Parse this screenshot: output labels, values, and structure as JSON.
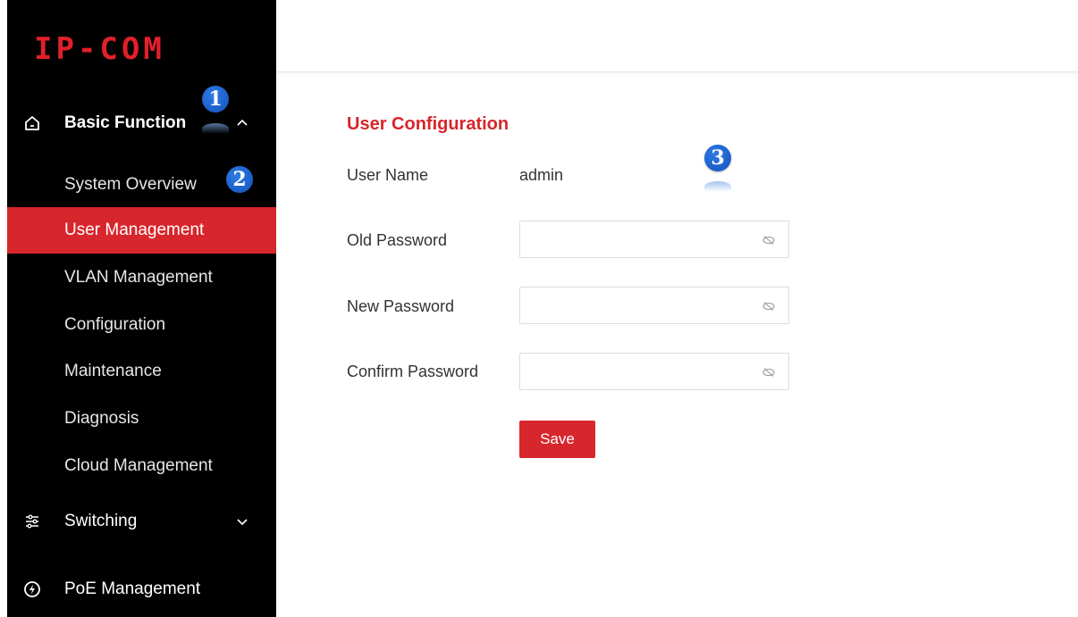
{
  "logo": {
    "text": "IP-COM"
  },
  "sidebar": {
    "groups": [
      {
        "label": "Basic Function",
        "icon": "home-icon",
        "expanded": true
      },
      {
        "label": "Switching",
        "icon": "sliders-icon",
        "expanded": false
      },
      {
        "label": "PoE Management",
        "icon": "power-icon"
      }
    ],
    "items": [
      {
        "label": "System Overview"
      },
      {
        "label": "User Management",
        "active": true
      },
      {
        "label": "VLAN Management"
      },
      {
        "label": "Configuration"
      },
      {
        "label": "Maintenance"
      },
      {
        "label": "Diagnosis"
      },
      {
        "label": "Cloud Management"
      }
    ]
  },
  "badges": [
    "1",
    "2",
    "3"
  ],
  "content": {
    "title": "User Configuration",
    "user_name_label": "User Name",
    "user_name_value": "admin",
    "old_password_label": "Old Password",
    "new_password_label": "New Password",
    "confirm_password_label": "Confirm Password",
    "old_password_value": "",
    "new_password_value": "",
    "confirm_password_value": "",
    "save_label": "Save"
  },
  "colors": {
    "accent": "#d7262c",
    "sidebar_bg": "#000000",
    "badge": "#1a5fd0"
  }
}
